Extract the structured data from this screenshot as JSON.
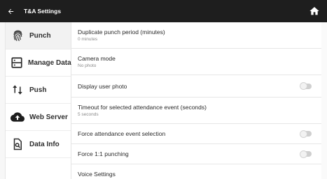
{
  "header": {
    "title": "T&A Settings",
    "back_icon": "arrow-left-icon",
    "home_icon": "home-icon"
  },
  "sidebar": {
    "items": [
      {
        "label": "Punch",
        "icon": "fingerprint-icon",
        "active": true
      },
      {
        "label": "Manage Data",
        "icon": "storage-icon"
      },
      {
        "label": "Push",
        "icon": "push-arrows-icon"
      },
      {
        "label": "Web Server",
        "icon": "cloud-upload-icon"
      },
      {
        "label": "Data Info",
        "icon": "document-search-icon"
      }
    ]
  },
  "settings": {
    "duplicate_punch": {
      "title": "Duplicate punch period (minutes)",
      "value": "0 minutes"
    },
    "camera_mode": {
      "title": "Camera mode",
      "value": "No photo"
    },
    "display_user_photo": {
      "title": "Display user photo",
      "enabled": false
    },
    "timeout_attendance": {
      "title": "Timeout for selected attendance event (seconds)",
      "value": "5 seconds"
    },
    "force_attendance_event": {
      "title": "Force attendance event selection",
      "enabled": false
    },
    "force_1_1_punching": {
      "title": "Force 1:1 punching",
      "enabled": false
    },
    "voice_settings": {
      "title": "Voice Settings"
    }
  }
}
